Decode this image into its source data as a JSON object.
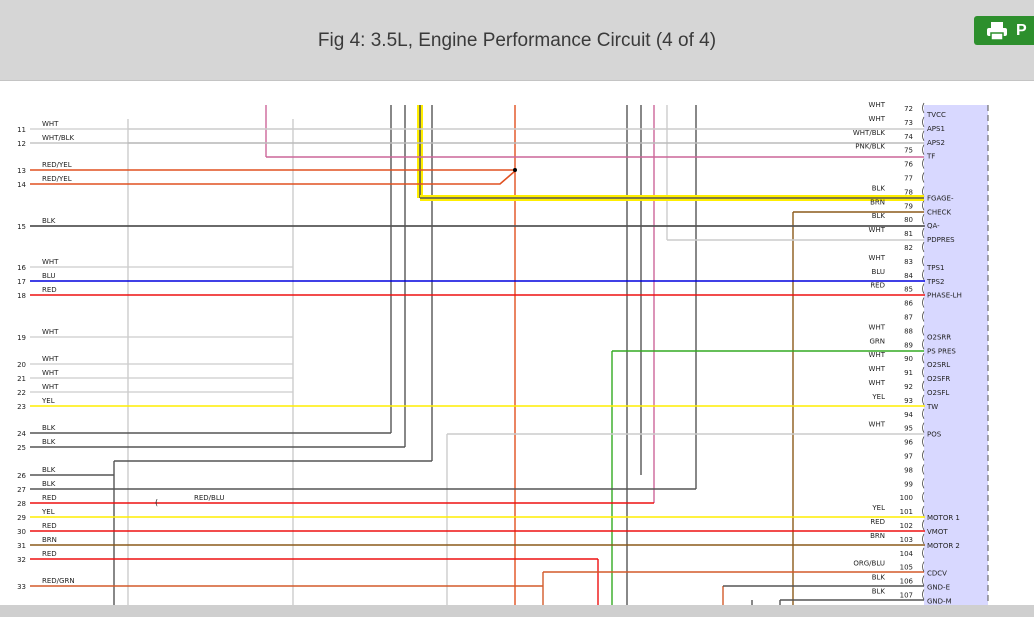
{
  "header": {
    "title": "Fig 4: 3.5L, Engine Performance Circuit (4 of 4)",
    "print_label": "P"
  },
  "left_pins": [
    {
      "pin": "11",
      "wire": "WHT",
      "color": "#cccccc"
    },
    {
      "pin": "12",
      "wire": "WHT/BLK",
      "color": "#bbbbbb"
    },
    {
      "pin": "13",
      "wire": "RED/YEL",
      "color": "#e05020"
    },
    {
      "pin": "14",
      "wire": "RED/YEL",
      "color": "#e05020"
    },
    {
      "pin": "15",
      "wire": "BLK",
      "color": "#555555"
    },
    {
      "pin": "16",
      "wire": "WHT",
      "color": "#cccccc"
    },
    {
      "pin": "17",
      "wire": "BLU",
      "color": "#0000dd"
    },
    {
      "pin": "18",
      "wire": "RED",
      "color": "#ee1111"
    },
    {
      "pin": "19",
      "wire": "WHT",
      "color": "#cccccc"
    },
    {
      "pin": "20",
      "wire": "WHT",
      "color": "#cccccc"
    },
    {
      "pin": "21",
      "wire": "WHT",
      "color": "#cccccc"
    },
    {
      "pin": "22",
      "wire": "WHT",
      "color": "#cccccc"
    },
    {
      "pin": "23",
      "wire": "YEL",
      "color": "#ffee00"
    },
    {
      "pin": "24",
      "wire": "BLK",
      "color": "#555555"
    },
    {
      "pin": "25",
      "wire": "BLK",
      "color": "#555555"
    },
    {
      "pin": "26",
      "wire": "BLK",
      "color": "#555555"
    },
    {
      "pin": "27",
      "wire": "BLK",
      "color": "#555555"
    },
    {
      "pin": "28",
      "wire": "RED",
      "color": "#ee1111"
    },
    {
      "pin": "29",
      "wire": "YEL",
      "color": "#ffee00"
    },
    {
      "pin": "30",
      "wire": "RED",
      "color": "#ee1111"
    },
    {
      "pin": "31",
      "wire": "BRN",
      "color": "#8b5a1a"
    },
    {
      "pin": "32",
      "wire": "RED",
      "color": "#ee1111"
    },
    {
      "pin": "33",
      "wire": "RED/GRN",
      "color": "#d35a2a"
    }
  ],
  "right_pins": [
    {
      "pin": "72",
      "wire": "WHT",
      "label": "TVCC"
    },
    {
      "pin": "73",
      "wire": "WHT",
      "label": "APS1"
    },
    {
      "pin": "74",
      "wire": "WHT/BLK",
      "label": "APS2"
    },
    {
      "pin": "75",
      "wire": "PNK/BLK",
      "label": "TF"
    },
    {
      "pin": "76",
      "wire": "",
      "label": ""
    },
    {
      "pin": "77",
      "wire": "",
      "label": ""
    },
    {
      "pin": "78",
      "wire": "BLK",
      "label": "FGAGE-"
    },
    {
      "pin": "79",
      "wire": "BRN",
      "label": "CHECK"
    },
    {
      "pin": "80",
      "wire": "BLK",
      "label": "QA-"
    },
    {
      "pin": "81",
      "wire": "WHT",
      "label": "PDPRES"
    },
    {
      "pin": "82",
      "wire": "",
      "label": ""
    },
    {
      "pin": "83",
      "wire": "WHT",
      "label": "TPS1"
    },
    {
      "pin": "84",
      "wire": "BLU",
      "label": "TPS2"
    },
    {
      "pin": "85",
      "wire": "RED",
      "label": "PHASE-LH"
    },
    {
      "pin": "86",
      "wire": "",
      "label": ""
    },
    {
      "pin": "87",
      "wire": "",
      "label": ""
    },
    {
      "pin": "88",
      "wire": "WHT",
      "label": "O2SRR"
    },
    {
      "pin": "89",
      "wire": "GRN",
      "label": "PS PRES"
    },
    {
      "pin": "90",
      "wire": "WHT",
      "label": "O2SRL"
    },
    {
      "pin": "91",
      "wire": "WHT",
      "label": "O2SFR"
    },
    {
      "pin": "92",
      "wire": "WHT",
      "label": "O2SFL"
    },
    {
      "pin": "93",
      "wire": "YEL",
      "label": "TW"
    },
    {
      "pin": "94",
      "wire": "",
      "label": ""
    },
    {
      "pin": "95",
      "wire": "WHT",
      "label": "POS"
    },
    {
      "pin": "96",
      "wire": "",
      "label": ""
    },
    {
      "pin": "97",
      "wire": "",
      "label": ""
    },
    {
      "pin": "98",
      "wire": "",
      "label": ""
    },
    {
      "pin": "99",
      "wire": "",
      "label": ""
    },
    {
      "pin": "100",
      "wire": "",
      "label": ""
    },
    {
      "pin": "101",
      "wire": "YEL",
      "label": "MOTOR 1"
    },
    {
      "pin": "102",
      "wire": "RED",
      "label": "VMOT"
    },
    {
      "pin": "103",
      "wire": "BRN",
      "label": "MOTOR 2"
    },
    {
      "pin": "104",
      "wire": "",
      "label": ""
    },
    {
      "pin": "105",
      "wire": "ORG/BLU",
      "label": "CDCV"
    },
    {
      "pin": "106",
      "wire": "BLK",
      "label": "GND-E"
    },
    {
      "pin": "107",
      "wire": "BLK",
      "label": "GND-M"
    }
  ],
  "inline_labels": {
    "red_blu": "RED/BLU"
  }
}
